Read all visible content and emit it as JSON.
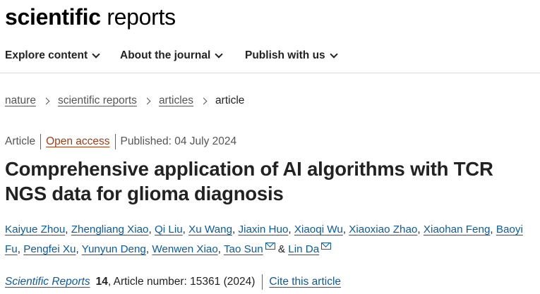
{
  "site": {
    "logo_bold": "scientific",
    "logo_light": " reports"
  },
  "nav": {
    "items": [
      {
        "label": "Explore content"
      },
      {
        "label": "About the journal"
      },
      {
        "label": "Publish with us"
      }
    ]
  },
  "breadcrumb": {
    "items": [
      "nature",
      "scientific reports",
      "articles"
    ],
    "current": "article"
  },
  "meta": {
    "type": "Article",
    "access": "Open access",
    "published": "Published: 04 July 2024"
  },
  "article": {
    "title": "Comprehensive application of AI algorithms with TCR NGS data for glioma diagnosis"
  },
  "authors": [
    "Kaiyue Zhou",
    "Zhengliang Xiao",
    "Qi Liu",
    "Xu Wang",
    "Jiaxin Huo",
    "Xiaoqi Wu",
    "Xiaoxiao Zhao",
    "Xiaohan Feng",
    "Baoyi Fu",
    "Pengfei Xu",
    "Yunyun Deng",
    "Wenwen Xiao",
    "Tao Sun",
    "Lin Da"
  ],
  "author_separator": ", ",
  "author_and": " & ",
  "citation": {
    "journal": "Scientific Reports",
    "volume": "14",
    "article_number": ", Article number: 15361 (2024)",
    "cite_link": "Cite this article"
  },
  "colors": {
    "link": "#0b5ba4",
    "open_access": "#a13e18",
    "text": "#222222",
    "muted": "#555555"
  }
}
